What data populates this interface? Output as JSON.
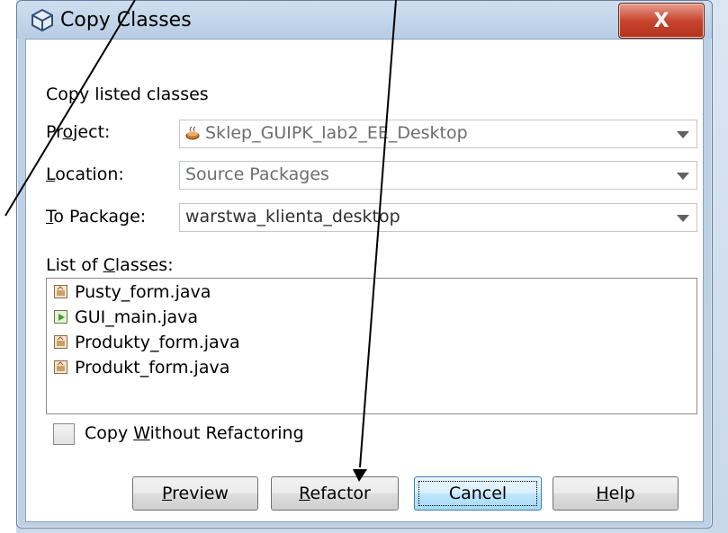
{
  "window": {
    "title": "Copy Classes",
    "close_label": "X"
  },
  "form": {
    "heading": "Copy listed classes",
    "project": {
      "label_pre": "Pr",
      "label_u": "o",
      "label_post": "ject:",
      "value": "Sklep_GUIPK_lab2_EE_Desktop"
    },
    "location": {
      "label_u": "L",
      "label_post": "ocation:",
      "value": "Source Packages"
    },
    "package": {
      "label_u": "T",
      "label_post": "o Package:",
      "value": "warstwa_klienta_desktop"
    },
    "classes": {
      "label_pre": "List of ",
      "label_u": "C",
      "label_post": "lasses:",
      "items": [
        "Pusty_form.java",
        "GUI_main.java",
        "Produkty_form.java",
        "Produkt_form.java"
      ]
    },
    "copy_without_refactoring": {
      "label_pre": "Copy ",
      "label_u": "W",
      "label_post": "ithout Refactoring",
      "checked": false
    }
  },
  "buttons": {
    "preview": {
      "u": "P",
      "rest": "review"
    },
    "refactor": {
      "u": "R",
      "rest": "efactor"
    },
    "cancel": {
      "label": "Cancel"
    },
    "help": {
      "u": "H",
      "rest": "elp"
    }
  },
  "colors": {
    "window_frame": "#bcd0e6",
    "close_button": "#c8462f",
    "default_button": "#bee6fd"
  }
}
